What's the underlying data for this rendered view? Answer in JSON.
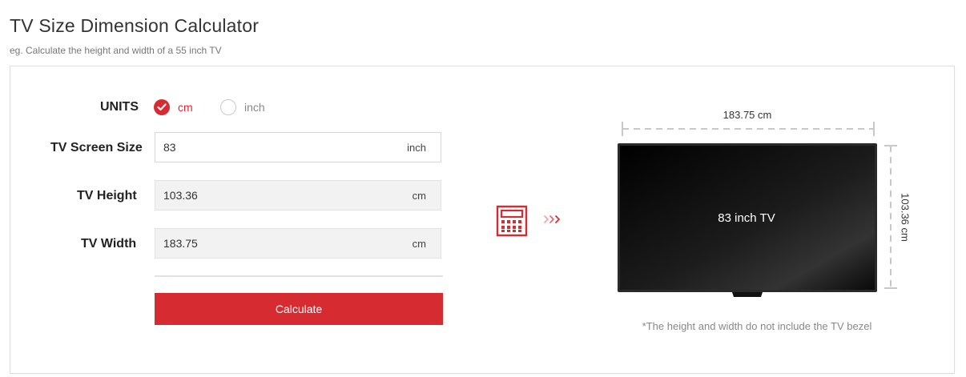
{
  "header": {
    "title": "TV Size Dimension Calculator",
    "subtitle": "eg. Calculate the height and width of a 55 inch TV"
  },
  "form": {
    "units_label": "UNITS",
    "units_options": [
      {
        "label": "cm",
        "selected": true
      },
      {
        "label": "inch",
        "selected": false
      }
    ],
    "screen_size": {
      "label": "TV Screen Size",
      "value": "83",
      "unit": "inch"
    },
    "height": {
      "label": "TV Height",
      "value": "103.36",
      "unit": "cm"
    },
    "width": {
      "label": "TV Width",
      "value": "183.75",
      "unit": "cm"
    },
    "calculate_label": "Calculate"
  },
  "illustration": {
    "width_label": "183.75 cm",
    "height_label": "103.36 cm",
    "tv_label": "83 inch TV",
    "note": "*The height and width do not include the TV bezel"
  },
  "colors": {
    "accent": "#d62b31",
    "field_readonly_bg": "#f2f2f2",
    "dimension_line": "#c8c8c8"
  },
  "icons": [
    "check-icon",
    "calculator-icon",
    "triple-chevron-right-icon"
  ]
}
